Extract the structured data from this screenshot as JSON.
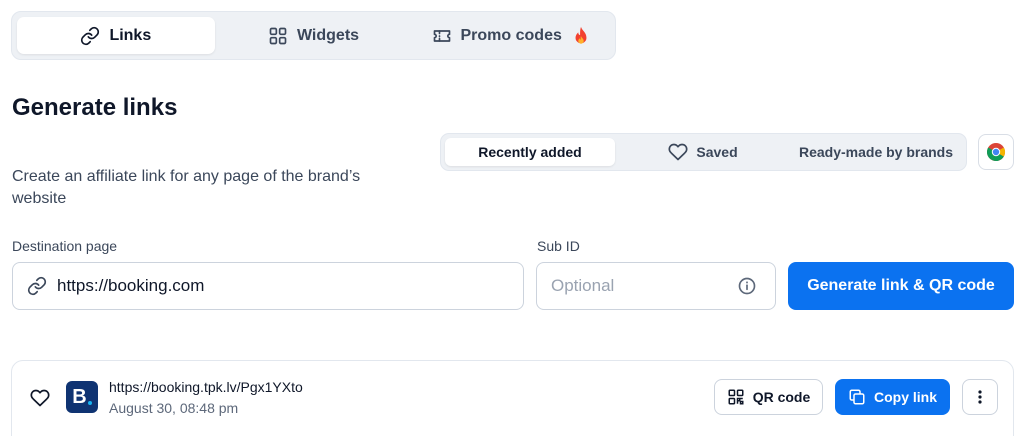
{
  "tabs": [
    {
      "label": "Links",
      "icon": "link-icon",
      "active": true
    },
    {
      "label": "Widgets",
      "icon": "grid-icon",
      "active": false
    },
    {
      "label": "Promo codes",
      "icon": "ticket-icon",
      "badge_icon": "fire-icon",
      "active": false
    }
  ],
  "page": {
    "title": "Generate links",
    "description": "Create an affiliate link for any page of the brand’s website"
  },
  "filters": [
    {
      "label": "Recently added",
      "active": true
    },
    {
      "label": "Saved",
      "icon": "heart-icon",
      "active": false
    },
    {
      "label": "Ready-made by brands",
      "active": false
    }
  ],
  "form": {
    "destination_label": "Destination page",
    "destination_value": "https://booking.com",
    "subid_label": "Sub ID",
    "subid_placeholder": "Optional",
    "generate_label": "Generate link & QR code"
  },
  "result": {
    "url": "https://booking.tpk.lv/Pgx1YXto",
    "date": "August 30, 08:48 pm",
    "brand_logo_text": "B",
    "qr_label": "QR code",
    "copy_label": "Copy link"
  },
  "colors": {
    "accent": "#0b72f0",
    "brand_logo_bg": "#0f3372"
  }
}
